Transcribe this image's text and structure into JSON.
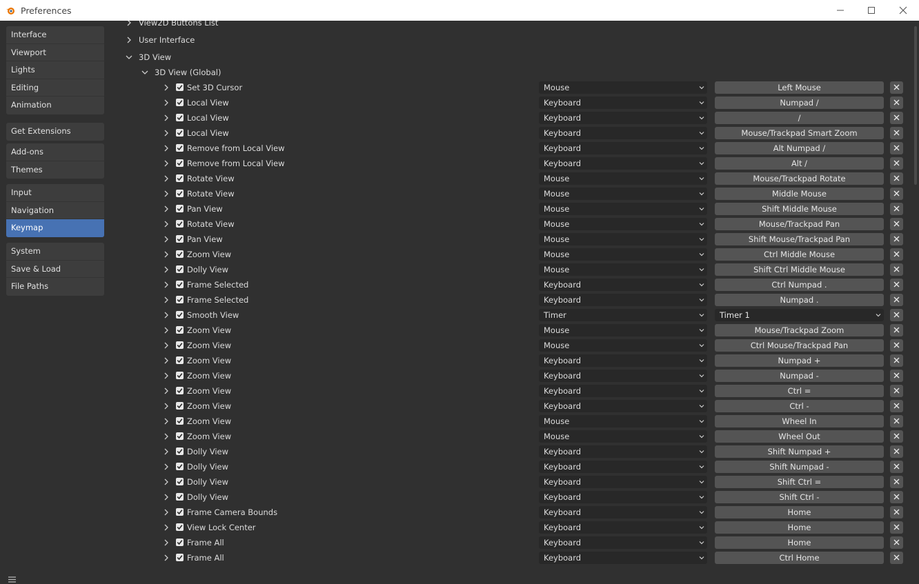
{
  "window": {
    "title": "Preferences",
    "logo_icon": "blender-logo-icon"
  },
  "sidebar": {
    "groups": [
      [
        "Interface",
        "Viewport",
        "Lights",
        "Editing",
        "Animation"
      ],
      [
        "Get Extensions"
      ],
      [
        "Add-ons",
        "Themes"
      ],
      [
        "Input",
        "Navigation",
        "Keymap"
      ],
      [
        "System",
        "Save & Load",
        "File Paths"
      ]
    ],
    "active": "Keymap"
  },
  "tree": {
    "view2d_buttons": "View2D Buttons List",
    "user_interface": "User Interface",
    "view3d": "3D View",
    "view3d_global": "3D View (Global)"
  },
  "colors": {
    "accent": "#4772b3",
    "panel": "#303030",
    "button": "#545454",
    "field": "#282828"
  },
  "keymap_items": [
    {
      "name": "Set 3D Cursor",
      "type": "Mouse",
      "key": "Left Mouse"
    },
    {
      "name": "Local View",
      "type": "Keyboard",
      "key": "Numpad /"
    },
    {
      "name": "Local View",
      "type": "Keyboard",
      "key": "/"
    },
    {
      "name": "Local View",
      "type": "Keyboard",
      "key": "Mouse/Trackpad Smart Zoom"
    },
    {
      "name": "Remove from Local View",
      "type": "Keyboard",
      "key": "Alt Numpad /"
    },
    {
      "name": "Remove from Local View",
      "type": "Keyboard",
      "key": "Alt /"
    },
    {
      "name": "Rotate View",
      "type": "Mouse",
      "key": "Mouse/Trackpad Rotate"
    },
    {
      "name": "Rotate View",
      "type": "Mouse",
      "key": "Middle Mouse"
    },
    {
      "name": "Pan View",
      "type": "Mouse",
      "key": "Shift Middle Mouse"
    },
    {
      "name": "Rotate View",
      "type": "Mouse",
      "key": "Mouse/Trackpad Pan"
    },
    {
      "name": "Pan View",
      "type": "Mouse",
      "key": "Shift Mouse/Trackpad Pan"
    },
    {
      "name": "Zoom View",
      "type": "Mouse",
      "key": "Ctrl Middle Mouse"
    },
    {
      "name": "Dolly View",
      "type": "Mouse",
      "key": "Shift Ctrl Middle Mouse"
    },
    {
      "name": "Frame Selected",
      "type": "Keyboard",
      "key": "Ctrl Numpad ."
    },
    {
      "name": "Frame Selected",
      "type": "Keyboard",
      "key": "Numpad ."
    },
    {
      "name": "Smooth View",
      "type": "Timer",
      "key": "Timer 1",
      "key_is_dropdown": true
    },
    {
      "name": "Zoom View",
      "type": "Mouse",
      "key": "Mouse/Trackpad Zoom"
    },
    {
      "name": "Zoom View",
      "type": "Mouse",
      "key": "Ctrl Mouse/Trackpad Pan"
    },
    {
      "name": "Zoom View",
      "type": "Keyboard",
      "key": "Numpad +"
    },
    {
      "name": "Zoom View",
      "type": "Keyboard",
      "key": "Numpad -"
    },
    {
      "name": "Zoom View",
      "type": "Keyboard",
      "key": "Ctrl ="
    },
    {
      "name": "Zoom View",
      "type": "Keyboard",
      "key": "Ctrl -"
    },
    {
      "name": "Zoom View",
      "type": "Mouse",
      "key": "Wheel In"
    },
    {
      "name": "Zoom View",
      "type": "Mouse",
      "key": "Wheel Out"
    },
    {
      "name": "Dolly View",
      "type": "Keyboard",
      "key": "Shift Numpad +"
    },
    {
      "name": "Dolly View",
      "type": "Keyboard",
      "key": "Shift Numpad -"
    },
    {
      "name": "Dolly View",
      "type": "Keyboard",
      "key": "Shift Ctrl ="
    },
    {
      "name": "Dolly View",
      "type": "Keyboard",
      "key": "Shift Ctrl -"
    },
    {
      "name": "Frame Camera Bounds",
      "type": "Keyboard",
      "key": "Home"
    },
    {
      "name": "View Lock Center",
      "type": "Keyboard",
      "key": "Home"
    },
    {
      "name": "Frame All",
      "type": "Keyboard",
      "key": "Home"
    },
    {
      "name": "Frame All",
      "type": "Keyboard",
      "key": "Ctrl Home"
    }
  ]
}
